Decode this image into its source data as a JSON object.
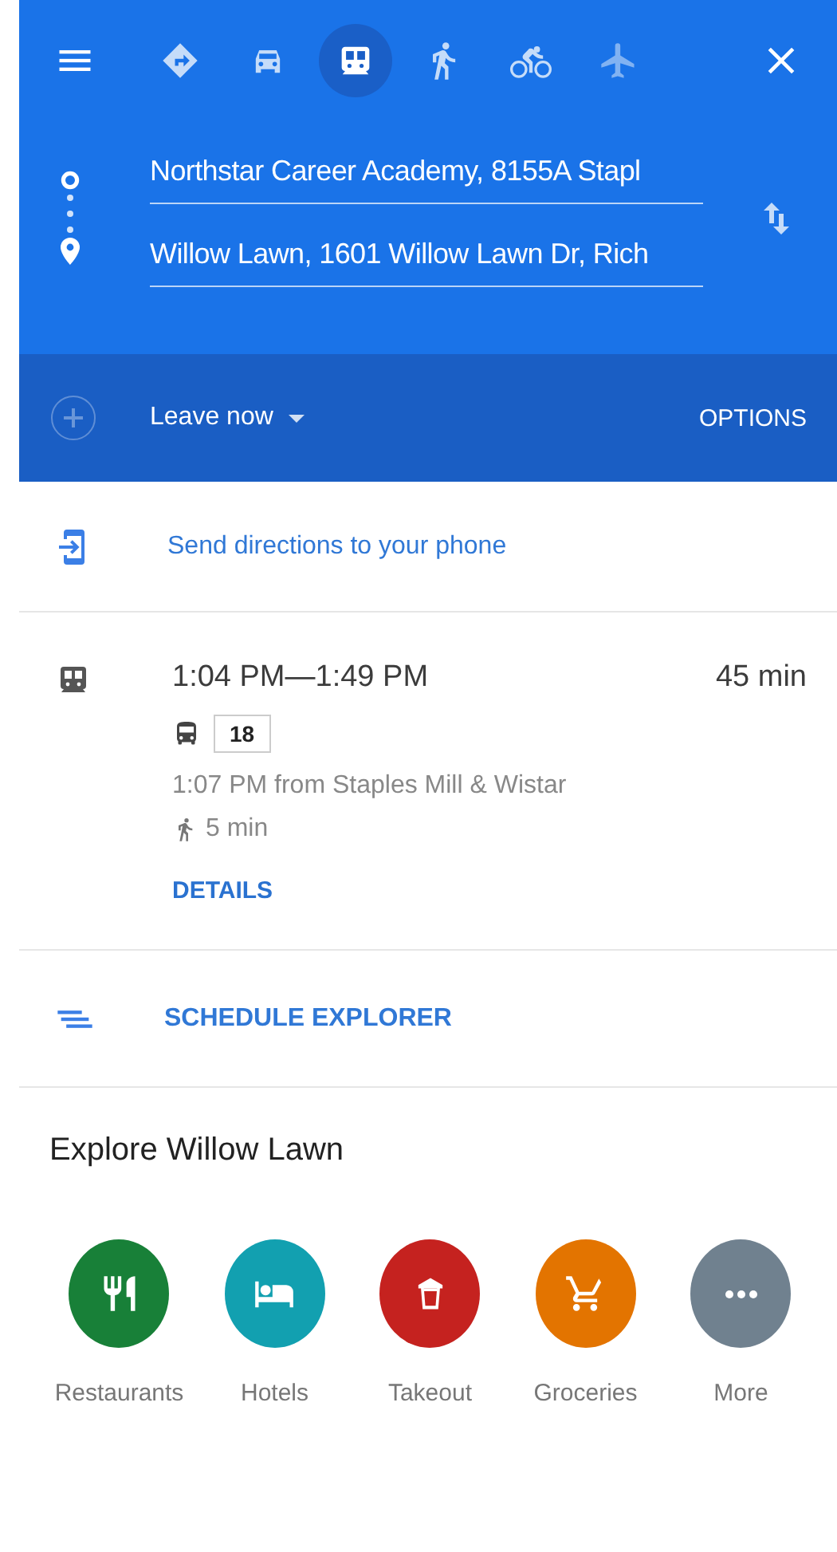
{
  "travel_modes": [
    {
      "kind": "best",
      "selected": false,
      "disabled": false
    },
    {
      "kind": "driving",
      "selected": false,
      "disabled": false
    },
    {
      "kind": "transit",
      "selected": true,
      "disabled": false
    },
    {
      "kind": "walking",
      "selected": false,
      "disabled": false
    },
    {
      "kind": "cycling",
      "selected": false,
      "disabled": false
    },
    {
      "kind": "flights",
      "selected": false,
      "disabled": true
    }
  ],
  "route": {
    "origin": "Northstar Career Academy, 8155A Stapl",
    "destination": "Willow Lawn, 1601 Willow Lawn Dr, Rich"
  },
  "time_bar": {
    "departure": "Leave now",
    "options": "OPTIONS"
  },
  "send_link": "Send directions to your phone",
  "trip": {
    "times": "1:04 PM—1:49 PM",
    "duration": "45 min",
    "route_badge": "18",
    "stop": "1:07 PM from Staples Mill & Wistar",
    "walk": "5 min",
    "details": "DETAILS"
  },
  "schedule_link": "SCHEDULE EXPLORER",
  "explore": {
    "title": "Explore Willow Lawn",
    "categories": [
      {
        "kind": "restaurants",
        "label": "Restaurants",
        "color": "#188038"
      },
      {
        "kind": "hotels",
        "label": "Hotels",
        "color": "#12a0b0"
      },
      {
        "kind": "takeout",
        "label": "Takeout",
        "color": "#c5221f"
      },
      {
        "kind": "groceries",
        "label": "Groceries",
        "color": "#e37400"
      },
      {
        "kind": "more",
        "label": "More",
        "color": "#70818f"
      }
    ]
  }
}
